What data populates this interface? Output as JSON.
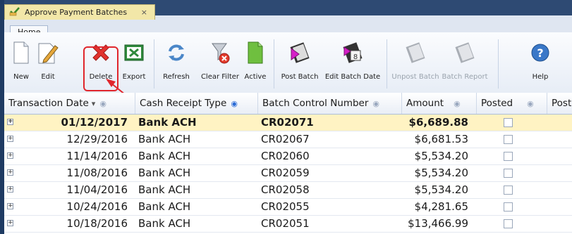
{
  "window": {
    "tab_title": "Approve Payment Batches",
    "close_glyph": "×"
  },
  "ribbon": {
    "tab_label": "Home",
    "buttons": [
      {
        "label": "New",
        "icon": "new-document-icon"
      },
      {
        "label": "Edit",
        "icon": "edit-pencil-icon"
      },
      {
        "label": "Delete",
        "icon": "delete-x-icon"
      },
      {
        "label": "Export",
        "icon": "excel-export-icon"
      },
      {
        "label": "Refresh",
        "icon": "refresh-icon"
      },
      {
        "label": "Clear Filter",
        "icon": "clear-filter-icon"
      },
      {
        "label": "Active",
        "icon": "active-document-icon"
      },
      {
        "label": "Post Batch",
        "icon": "post-batch-icon"
      },
      {
        "label": "Edit Batch Date",
        "icon": "edit-batch-date-icon"
      },
      {
        "label": "Unpost Batch",
        "icon": "unpost-batch-icon"
      },
      {
        "label": "Batch Report",
        "icon": "batch-report-icon"
      },
      {
        "label": "Help",
        "icon": "help-icon"
      }
    ]
  },
  "grid": {
    "columns": [
      "Transaction Date",
      "Cash Receipt Type",
      "Batch Control Number",
      "Amount",
      "Posted",
      "Posted"
    ],
    "rows": [
      {
        "date": "01/12/2017",
        "type": "Bank ACH",
        "batch": "CR02071",
        "amount": "$6,689.88",
        "posted": false
      },
      {
        "date": "12/29/2016",
        "type": "Bank ACH",
        "batch": "CR02067",
        "amount": "$6,681.53",
        "posted": false
      },
      {
        "date": "11/14/2016",
        "type": "Bank ACH",
        "batch": "CR02060",
        "amount": "$5,534.20",
        "posted": false
      },
      {
        "date": "11/08/2016",
        "type": "Bank ACH",
        "batch": "CR02059",
        "amount": "$5,534.20",
        "posted": false
      },
      {
        "date": "11/04/2016",
        "type": "Bank ACH",
        "batch": "CR02058",
        "amount": "$5,534.20",
        "posted": false
      },
      {
        "date": "10/24/2016",
        "type": "Bank ACH",
        "batch": "CR02055",
        "amount": "$4,281.65",
        "posted": false
      },
      {
        "date": "10/18/2016",
        "type": "Bank ACH",
        "batch": "CR02051",
        "amount": "$13,466.99",
        "posted": false
      }
    ],
    "expander_glyph": "+",
    "sort_glyph": "▾"
  },
  "colors": {
    "selected_row": "#fff3c3",
    "annotation": "#e0262c",
    "tab_strip": "#2e4a73"
  }
}
